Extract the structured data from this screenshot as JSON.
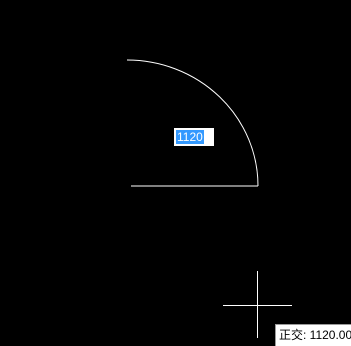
{
  "dynamic_input": {
    "value": "1120"
  },
  "tooltip": {
    "text": "正交: 1120.00"
  },
  "colors": {
    "background": "#000000",
    "geometry": "#ffffff",
    "input_selection": "#3399ff"
  }
}
